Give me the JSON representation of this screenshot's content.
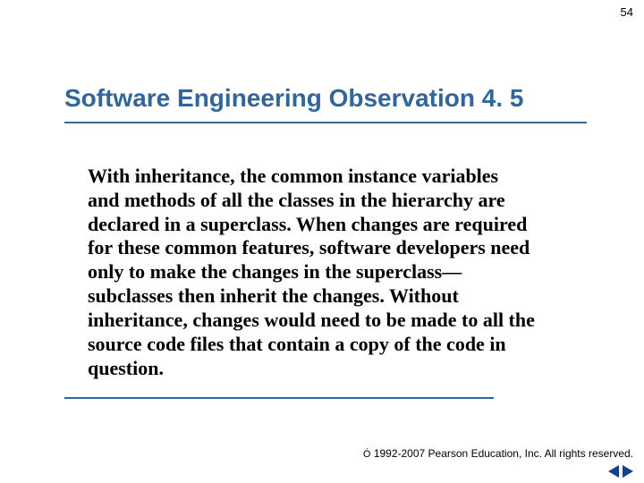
{
  "page_number": "54",
  "title": "Software Engineering Observation 4. 5",
  "body": "With inheritance, the common instance variables and methods of all the classes in the hierarchy are declared in a superclass. When changes are required for these common features, software developers need only to make the changes in the superclass—subclasses then inherit the changes. Without inheritance, changes would need to be made to all the source code files that contain a copy of the code in question.",
  "footer": {
    "copyright_symbol": "Ó",
    "text": " 1992-2007 Pearson Education, Inc.  All rights reserved."
  }
}
